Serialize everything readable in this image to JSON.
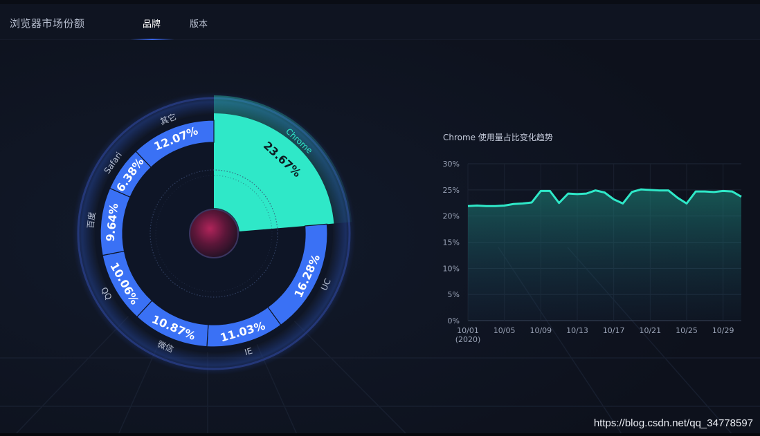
{
  "header": {
    "title": "浏览器市场份额",
    "tabs": [
      {
        "label": "品牌",
        "active": true
      },
      {
        "label": "版本",
        "active": false
      }
    ]
  },
  "colors": {
    "accent": "#2fe8c8",
    "segment": "#3a71f5",
    "background": "#0d111c",
    "tab_underline": "#3e6eff"
  },
  "chart_data": [
    {
      "type": "pie",
      "categories": [
        "Chrome",
        "UC",
        "IE",
        "微信",
        "QQ",
        "百度",
        "Safari",
        "其它"
      ],
      "values": [
        23.67,
        16.28,
        11.03,
        10.87,
        10.06,
        9.64,
        6.38,
        12.07
      ],
      "value_labels": [
        "23.67%",
        "16.28%",
        "11.03%",
        "10.87%",
        "10.06%",
        "9.64%",
        "6.38%",
        "12.07%"
      ],
      "highlighted": "Chrome"
    },
    {
      "type": "area",
      "title": "Chrome 使用量占比变化趋势",
      "x": [
        "10/01",
        "10/02",
        "10/03",
        "10/04",
        "10/05",
        "10/06",
        "10/07",
        "10/08",
        "10/09",
        "10/10",
        "10/11",
        "10/12",
        "10/13",
        "10/14",
        "10/15",
        "10/16",
        "10/17",
        "10/18",
        "10/19",
        "10/20",
        "10/21",
        "10/22",
        "10/23",
        "10/24",
        "10/25",
        "10/26",
        "10/27",
        "10/28",
        "10/29",
        "10/30",
        "10/31"
      ],
      "x_tick_labels": [
        "10/01",
        "10/05",
        "10/09",
        "10/13",
        "10/17",
        "10/21",
        "10/25",
        "10/29"
      ],
      "x_year_label": "(2020)",
      "series": [
        {
          "values": [
            21.9,
            22.0,
            21.9,
            21.9,
            22.0,
            22.3,
            22.4,
            22.6,
            24.8,
            24.8,
            22.5,
            24.3,
            24.2,
            24.3,
            24.9,
            24.5,
            23.2,
            22.4,
            24.6,
            25.1,
            25.0,
            24.9,
            24.9,
            23.5,
            22.4,
            24.7,
            24.7,
            24.6,
            24.8,
            24.7,
            23.7
          ]
        }
      ],
      "yticks": [
        "0%",
        "5%",
        "10%",
        "15%",
        "20%",
        "25%",
        "30%"
      ],
      "ylim": [
        0,
        30
      ],
      "grid": true
    }
  ],
  "watermark": "https://blog.csdn.net/qq_34778597"
}
